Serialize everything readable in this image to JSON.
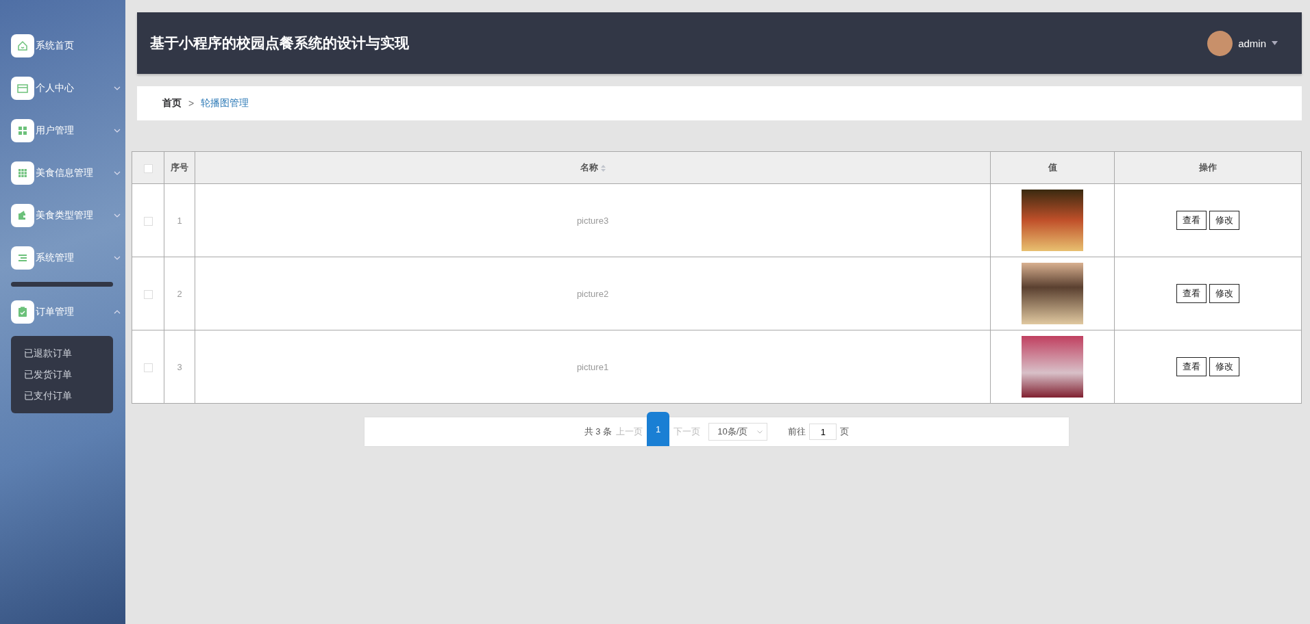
{
  "sidebar": {
    "items": [
      {
        "label": "系统首页",
        "kind": "link"
      },
      {
        "label": "个人中心",
        "kind": "menu",
        "expanded": false
      },
      {
        "label": "用户管理",
        "kind": "menu",
        "expanded": false
      },
      {
        "label": "美食信息管理",
        "kind": "menu",
        "expanded": false
      },
      {
        "label": "美食类型管理",
        "kind": "menu",
        "expanded": false
      },
      {
        "label": "系统管理",
        "kind": "menu",
        "expanded": false
      },
      {
        "label": "订单管理",
        "kind": "menu",
        "expanded": true,
        "children": [
          {
            "label": "已退款订单"
          },
          {
            "label": "已发货订单"
          },
          {
            "label": "已支付订单"
          }
        ]
      }
    ]
  },
  "header": {
    "title": "基于小程序的校园点餐系统的设计与实现",
    "user": "admin"
  },
  "breadcrumb": {
    "home": "首页",
    "separator": ">",
    "current": "轮播图管理"
  },
  "table": {
    "header_checked": false,
    "columns": [
      "序号",
      "名称",
      "值",
      "操作"
    ],
    "rows": [
      {
        "checked": false,
        "index": "1",
        "name": "picture3",
        "actions": [
          "查看",
          "修改"
        ]
      },
      {
        "checked": false,
        "index": "2",
        "name": "picture2",
        "actions": [
          "查看",
          "修改"
        ]
      },
      {
        "checked": false,
        "index": "3",
        "name": "picture1",
        "actions": [
          "查看",
          "修改"
        ]
      }
    ]
  },
  "pagination": {
    "total": "共 3 条",
    "prev": "上一页",
    "pages": [
      {
        "label": "1",
        "selected": true
      }
    ],
    "next": "下一页",
    "page_size": "10条/页",
    "goto": "前往",
    "page_value": "1",
    "page_suffix": "页"
  }
}
